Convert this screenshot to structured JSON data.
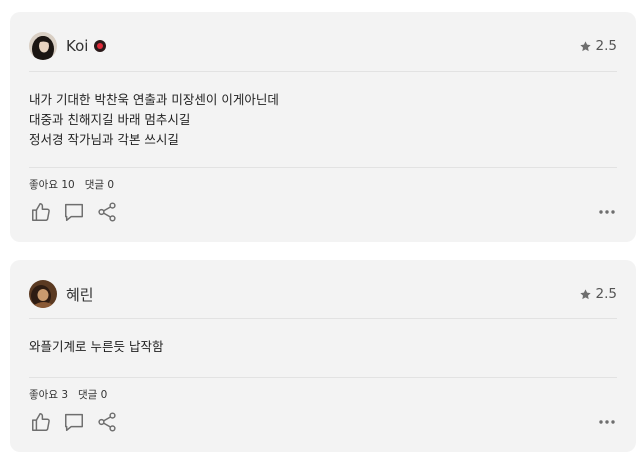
{
  "reviews": [
    {
      "username": "Koi",
      "rating": "2.5",
      "lines": [
        "내가 기대한 박찬욱 연출과 미장센이 이게아닌데",
        "대중과 친해지길 바래 멈추시길",
        "정서경 작가님과 각본 쓰시길"
      ],
      "likes_label": "좋아요 10",
      "comments_label": "댓글 0"
    },
    {
      "username": "혜린",
      "rating": "2.5",
      "lines": [
        "와플기계로 누른듯 납작함"
      ],
      "likes_label": "좋아요 3",
      "comments_label": "댓글 0"
    }
  ],
  "colors": {
    "card_bg": "#f3f3f3",
    "icon": "#6e6e6e",
    "badge_dot": "#e02a3a"
  }
}
